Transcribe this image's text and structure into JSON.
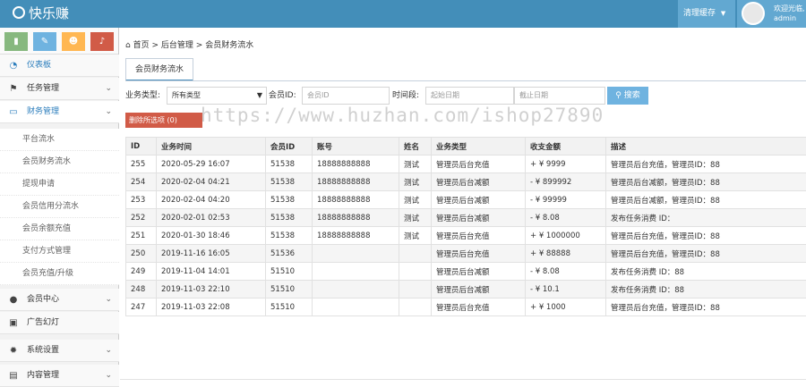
{
  "app": {
    "title": "快乐赚"
  },
  "header": {
    "clear_cache": "清理缓存",
    "welcome": "欢迎光临,",
    "username": "admin"
  },
  "sidebar": {
    "shortcuts": [
      {
        "icon": "bar-chart-icon",
        "glyph": "▮",
        "color": "#87b87f"
      },
      {
        "icon": "pencil-icon",
        "glyph": "✎",
        "color": "#6fb3e0"
      },
      {
        "icon": "users-icon",
        "glyph": "☻",
        "color": "#ffb752"
      },
      {
        "icon": "bell-icon",
        "glyph": "♫",
        "color": "#d15b47"
      }
    ],
    "items": [
      {
        "label": "仪表板",
        "icon": "dashboard-icon",
        "glyph": "◔",
        "expandable": false
      },
      {
        "label": "任务管理",
        "icon": "flag-icon",
        "glyph": "⚑",
        "expandable": true
      },
      {
        "label": "财务管理",
        "icon": "inbox-icon",
        "glyph": "▭",
        "expandable": true,
        "active": true
      },
      {
        "label": "会员中心",
        "icon": "user-icon",
        "glyph": "●",
        "expandable": true
      },
      {
        "label": "广告幻灯",
        "icon": "picture-icon",
        "glyph": "▣",
        "expandable": false
      },
      {
        "label": "系统设置",
        "icon": "gear-icon",
        "glyph": "✹",
        "expandable": true
      },
      {
        "label": "内容管理",
        "icon": "book-icon",
        "glyph": "▤",
        "expandable": true
      }
    ],
    "sub_items": [
      "平台流水",
      "会员财务流水",
      "提现申请",
      "会员信用分流水",
      "会员余额充值",
      "支付方式管理",
      "会员充值/升级"
    ]
  },
  "breadcrumb": {
    "home": "首页",
    "section": "后台管理",
    "page": "会员财务流水"
  },
  "tab": {
    "label": "会员财务流水"
  },
  "filters": {
    "type_label": "业务类型:",
    "type_value": "所有类型",
    "member_label": "会员ID:",
    "member_placeholder": "会员ID",
    "period_label": "时间段:",
    "start_placeholder": "起始日期",
    "end_placeholder": "截止日期",
    "search_label": "搜索"
  },
  "actions": {
    "delete_label": "删除所选项 (0)"
  },
  "watermark": "https://www.huzhan.com/ishop27890",
  "table": {
    "headers": [
      "ID",
      "业务时间",
      "会员ID",
      "账号",
      "姓名",
      "业务类型",
      "收支金额",
      "描述"
    ],
    "rows": [
      [
        "255",
        "2020-05-29 16:07",
        "51538",
        "18888888888",
        "测试",
        "管理员后台充值",
        "+ ¥ 9999",
        "管理员后台充值，管理员ID：88"
      ],
      [
        "254",
        "2020-02-04 04:21",
        "51538",
        "18888888888",
        "测试",
        "管理员后台减额",
        "- ¥ 899992",
        "管理员后台减额，管理员ID：88"
      ],
      [
        "253",
        "2020-02-04 04:20",
        "51538",
        "18888888888",
        "测试",
        "管理员后台减额",
        "- ¥ 99999",
        "管理员后台减额，管理员ID：88"
      ],
      [
        "252",
        "2020-02-01 02:53",
        "51538",
        "18888888888",
        "测试",
        "管理员后台减额",
        "- ¥ 8.08",
        "发布任务消费 ID："
      ],
      [
        "251",
        "2020-01-30 18:46",
        "51538",
        "18888888888",
        "测试",
        "管理员后台充值",
        "+ ¥ 1000000",
        "管理员后台充值，管理员ID：88"
      ],
      [
        "250",
        "2019-11-16 16:05",
        "51536",
        "",
        "",
        "管理员后台充值",
        "+ ¥ 88888",
        "管理员后台充值，管理员ID：88"
      ],
      [
        "249",
        "2019-11-04 14:01",
        "51510",
        "",
        "",
        "管理员后台减额",
        "- ¥ 8.08",
        "发布任务消费 ID：88"
      ],
      [
        "248",
        "2019-11-03 22:10",
        "51510",
        "",
        "",
        "管理员后台减额",
        "- ¥ 10.1",
        "发布任务消费 ID：88"
      ],
      [
        "247",
        "2019-11-03 22:08",
        "51510",
        "",
        "",
        "管理员后台充值",
        "+ ¥ 1000",
        "管理员后台充值，管理员ID：88"
      ]
    ]
  }
}
